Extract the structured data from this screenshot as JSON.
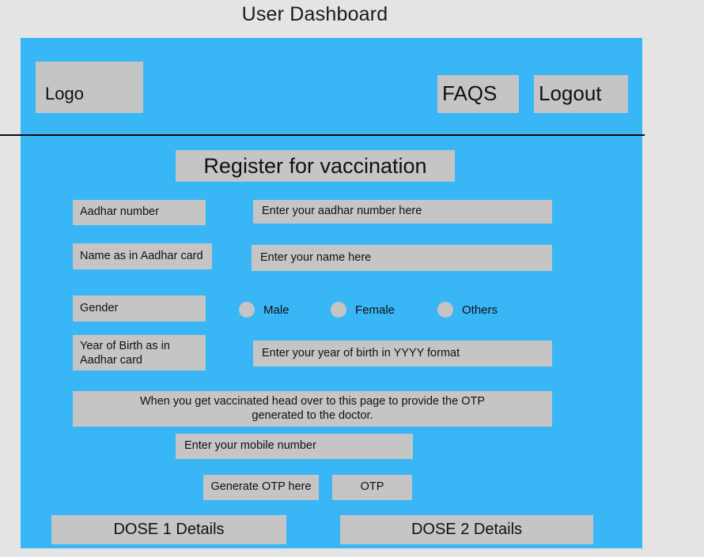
{
  "page": {
    "title": "User Dashboard",
    "panel_color": "#38b6f5",
    "box_color": "#c5c5c5",
    "background_color": "#e4e4e4"
  },
  "header": {
    "logo_label": "Logo",
    "faqs_label": "FAQS",
    "logout_label": "Logout"
  },
  "form": {
    "section_title": "Register for vaccination",
    "fields": [
      {
        "label": "Aadhar number",
        "placeholder": "Enter your aadhar number here"
      },
      {
        "label": "Name as in Aadhar card",
        "placeholder": "Enter your name here"
      },
      {
        "label": "Gender"
      },
      {
        "label": "Year of Birth as in\nAadhar card",
        "placeholder": "Enter your year of birth in YYYY format"
      }
    ],
    "gender_options": [
      {
        "label": "Male",
        "selected": false
      },
      {
        "label": "Female",
        "selected": false
      },
      {
        "label": "Others",
        "selected": false
      }
    ]
  },
  "otp_section": {
    "notice": "When you get vaccinated head over to this page to provide the OTP\ngenerated to the doctor.",
    "mobile_placeholder": "Enter your mobile number",
    "generate_button_label": "Generate OTP here",
    "otp_field_label": "OTP"
  },
  "doses": {
    "dose1_label": "DOSE 1 Details",
    "dose2_label": "DOSE 2 Details"
  }
}
